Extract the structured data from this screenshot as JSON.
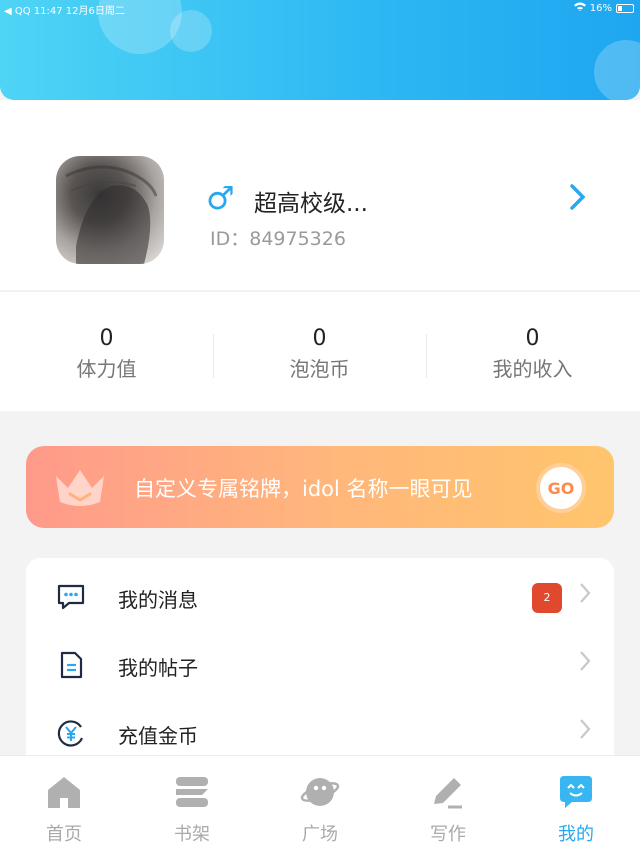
{
  "status_bar": {
    "left": "◀ QQ   11:47   12月6日周二",
    "right": "16%"
  },
  "profile": {
    "gender_symbol": "♂",
    "username": "超高校级...",
    "id_text": "ID：84975326"
  },
  "stats": [
    {
      "value": "0",
      "label": "体力值"
    },
    {
      "value": "0",
      "label": "泡泡币"
    },
    {
      "value": "0",
      "label": "我的收入"
    }
  ],
  "banner": {
    "text": "自定义专属铭牌，idol 名称一眼可见",
    "go_label": "GO"
  },
  "menu": [
    {
      "label": "我的消息",
      "badge": "2"
    },
    {
      "label": "我的帖子"
    },
    {
      "label": "充值金币"
    }
  ],
  "tabs": [
    {
      "label": "首页"
    },
    {
      "label": "书架"
    },
    {
      "label": "广场"
    },
    {
      "label": "写作"
    },
    {
      "label": "我的"
    }
  ],
  "colors": {
    "accent": "#2aa7ee",
    "badge": "#e0492d"
  },
  "icons": [
    "message-icon",
    "post-icon",
    "coin-icon",
    "home-icon",
    "bookshelf-icon",
    "plaza-icon",
    "write-icon",
    "mine-icon",
    "crown-icon"
  ]
}
